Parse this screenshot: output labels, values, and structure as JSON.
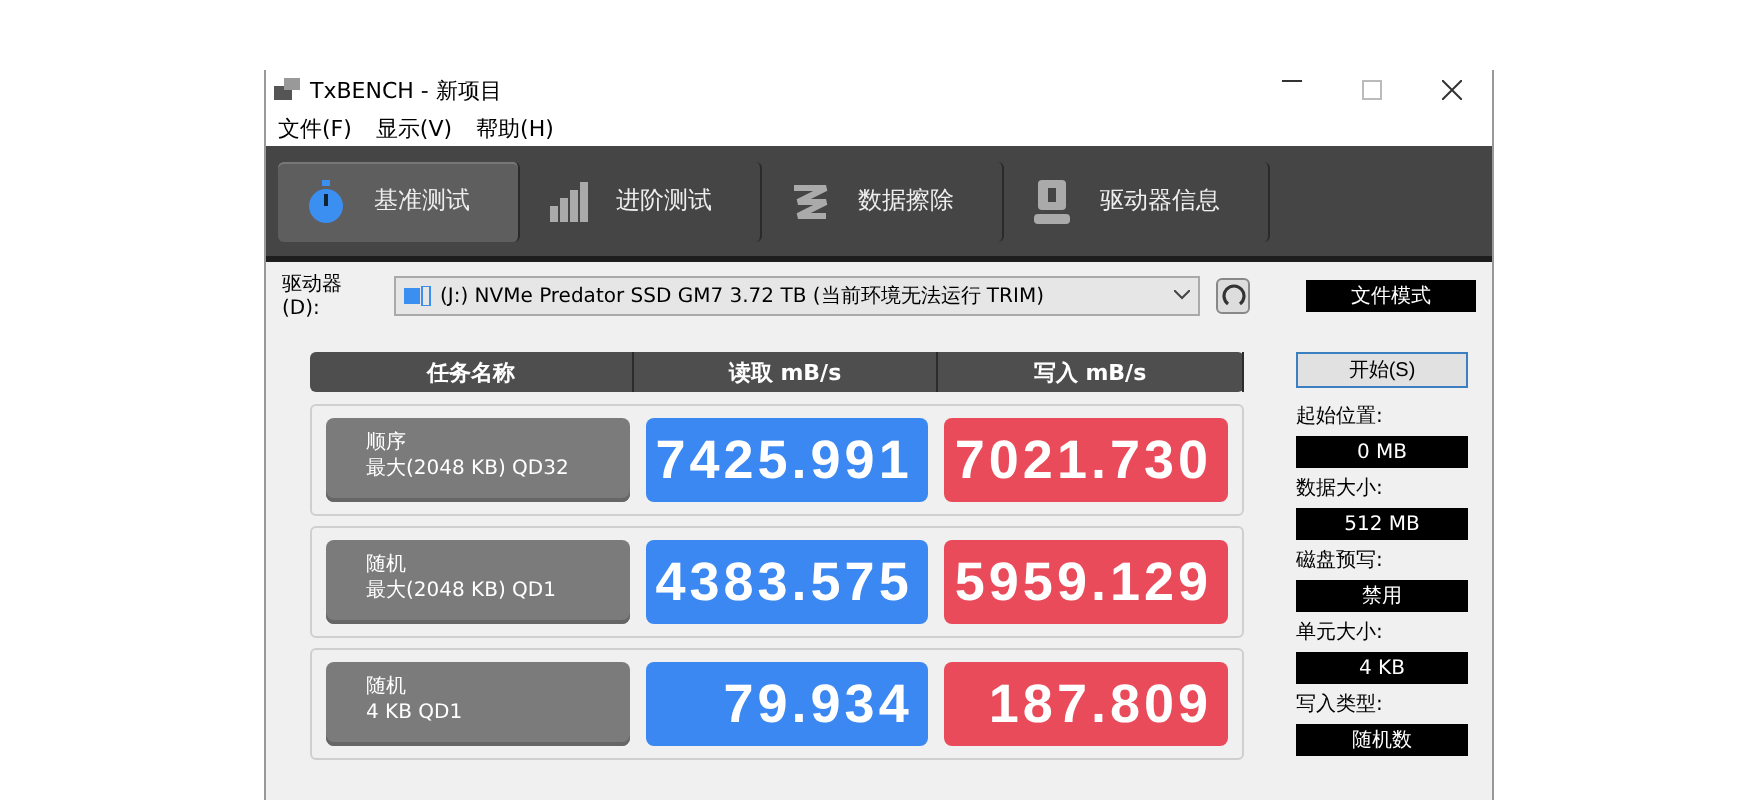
{
  "window": {
    "title": "TxBENCH - 新项目"
  },
  "menu": [
    "文件(F)",
    "显示(V)",
    "帮助(H)"
  ],
  "tabs": [
    {
      "label": "基准测试",
      "kind": "stopwatch",
      "selected": true
    },
    {
      "label": "进阶测试",
      "kind": "bars",
      "selected": false
    },
    {
      "label": "数据擦除",
      "kind": "eraser",
      "selected": false
    },
    {
      "label": "驱动器信息",
      "kind": "drive",
      "selected": false
    }
  ],
  "drive": {
    "label": "驱动器(D):",
    "value": "(J:) NVMe Predator SSD GM7  3.72 TB (当前环境无法运行 TRIM)"
  },
  "mode_button": "文件模式",
  "table": {
    "columns": [
      "任务名称",
      "读取 mB/s",
      "写入 mB/s"
    ],
    "rows": [
      {
        "name": "顺序",
        "detail": "最大(2048 KB) QD32",
        "read": "7425.991",
        "write": "7021.730"
      },
      {
        "name": "随机",
        "detail": "最大(2048 KB) QD1",
        "read": "4383.575",
        "write": "5959.129"
      },
      {
        "name": "随机",
        "detail": "4 KB QD1",
        "read": "79.934",
        "write": "187.809"
      }
    ]
  },
  "start_button": "开始(S)",
  "settings": [
    {
      "label": "起始位置:",
      "value": "0 MB"
    },
    {
      "label": "数据大小:",
      "value": "512 MB"
    },
    {
      "label": "磁盘预写:",
      "value": "禁用"
    },
    {
      "label": "单元大小:",
      "value": "4 KB"
    },
    {
      "label": "写入类型:",
      "value": "随机数"
    }
  ]
}
